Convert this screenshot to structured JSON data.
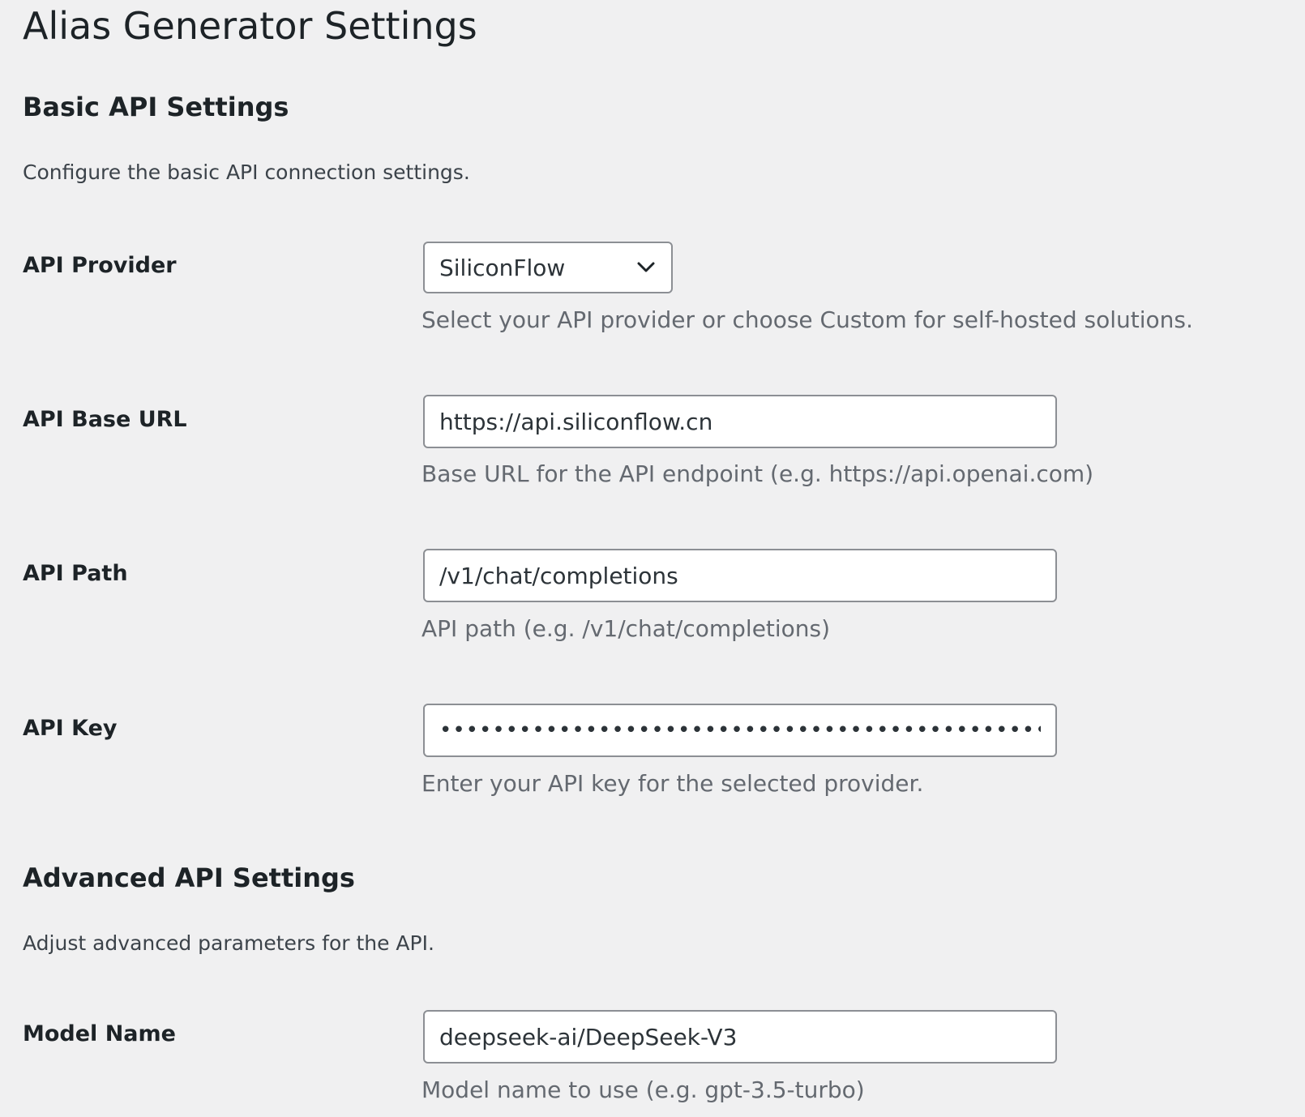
{
  "page": {
    "title": "Alias Generator Settings"
  },
  "basic": {
    "title": "Basic API Settings",
    "description": "Configure the basic API connection settings.",
    "provider": {
      "label": "API Provider",
      "selected": "SiliconFlow",
      "help": "Select your API provider or choose Custom for self-hosted solutions."
    },
    "base_url": {
      "label": "API Base URL",
      "value": "https://api.siliconflow.cn",
      "help": "Base URL for the API endpoint (e.g. https://api.openai.com)"
    },
    "path": {
      "label": "API Path",
      "value": "/v1/chat/completions",
      "help": "API path (e.g. /v1/chat/completions)"
    },
    "key": {
      "label": "API Key",
      "value": "sk-xxxxxxxxxxxxxxxxxxxxxxxxxxxxxxxxxxxxxxxxxxxxxxxxx",
      "help": "Enter your API key for the selected provider."
    }
  },
  "advanced": {
    "title": "Advanced API Settings",
    "description": "Adjust advanced parameters for the API.",
    "model": {
      "label": "Model Name",
      "value": "deepseek-ai/DeepSeek-V3",
      "help": "Model name to use (e.g. gpt-3.5-turbo)"
    }
  },
  "icons": {
    "select_arrow": "chevron-down-icon"
  },
  "colors": {
    "background": "#f0f0f1",
    "text": "#1d2327",
    "help_text": "#646970",
    "input_border": "#8c8f94"
  }
}
